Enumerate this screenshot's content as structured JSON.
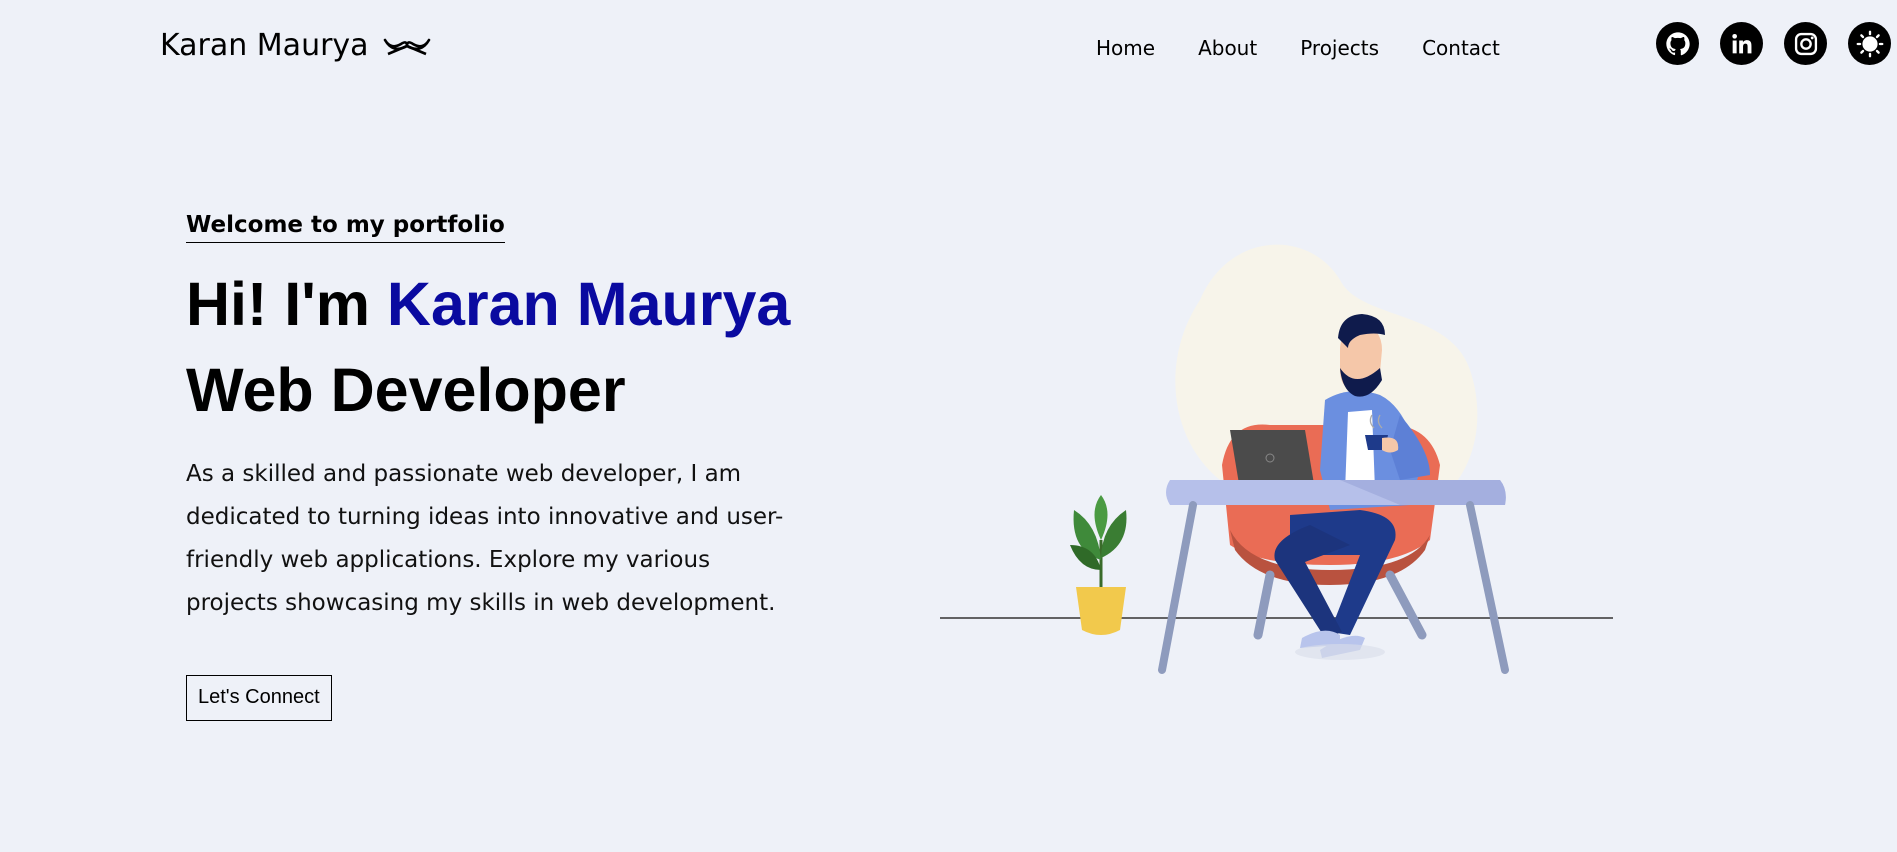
{
  "header": {
    "logo_text": "Karan Maurya",
    "logo_icon": "mustache-icon",
    "nav": [
      {
        "label": "Home"
      },
      {
        "label": "About"
      },
      {
        "label": "Projects"
      },
      {
        "label": "Contact"
      }
    ],
    "socials": [
      {
        "icon": "github-icon"
      },
      {
        "icon": "linkedin-icon"
      },
      {
        "icon": "instagram-icon"
      },
      {
        "icon": "theme-toggle-icon"
      }
    ]
  },
  "hero": {
    "welcome": "Welcome to my portfolio",
    "greeting": "Hi! I'm ",
    "name": "Karan Maurya",
    "role": "Web Developer",
    "description": "As a skilled and passionate web developer, I am dedicated to turning ideas into innovative and user-friendly web applications. Explore my various projects showcasing my skills in web development.",
    "cta_label": "Let's Connect"
  },
  "colors": {
    "background": "#eef1f8",
    "accent": "#0a0aa0"
  }
}
